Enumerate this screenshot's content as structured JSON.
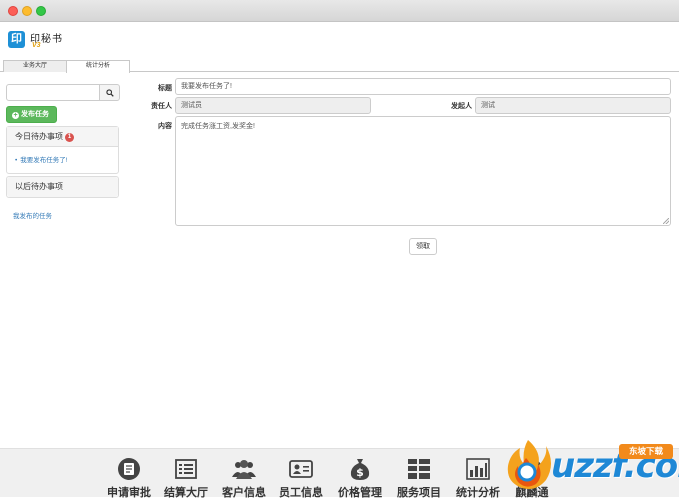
{
  "app": {
    "logo_text": "印秘书",
    "logo_glyph": "印",
    "logo_version": "V3"
  },
  "tabs": [
    {
      "label": "业务大厅",
      "active": false
    },
    {
      "label": "统计分析",
      "active": true
    }
  ],
  "sidebar": {
    "search_placeholder": "",
    "publish_button": "发布任务",
    "today_title": "今日待办事项",
    "today_count": "1",
    "today_items": [
      "我要发布任务了!"
    ],
    "later_title": "以后待办事项",
    "my_tasks_link": "我发布的任务"
  },
  "form": {
    "title_label": "标题",
    "title_value": "我要发布任务了!",
    "assignee_label": "责任人",
    "assignee_value": "测试员",
    "initiator_label": "发起人",
    "initiator_value": "测试",
    "content_label": "内容",
    "content_value": "完成任务涨工资,发奖金!",
    "claim_button": "领取"
  },
  "dock": [
    {
      "label": "申请审批",
      "icon": "approval-icon"
    },
    {
      "label": "结算大厅",
      "icon": "settlement-icon"
    },
    {
      "label": "客户信息",
      "icon": "customers-icon"
    },
    {
      "label": "员工信息",
      "icon": "employee-card-icon"
    },
    {
      "label": "价格管理",
      "icon": "money-bag-icon"
    },
    {
      "label": "服务项目",
      "icon": "services-grid-icon"
    },
    {
      "label": "统计分析",
      "icon": "bar-chart-icon"
    },
    {
      "label": "麒麟通",
      "icon": "qilin-icon"
    }
  ],
  "watermark": {
    "text": "uzzf.com",
    "tag": "东坡下载"
  },
  "colors": {
    "accent": "#337ab7",
    "success": "#5cb85c",
    "badge": "#d9534f",
    "watermark": "#1e88d6"
  }
}
